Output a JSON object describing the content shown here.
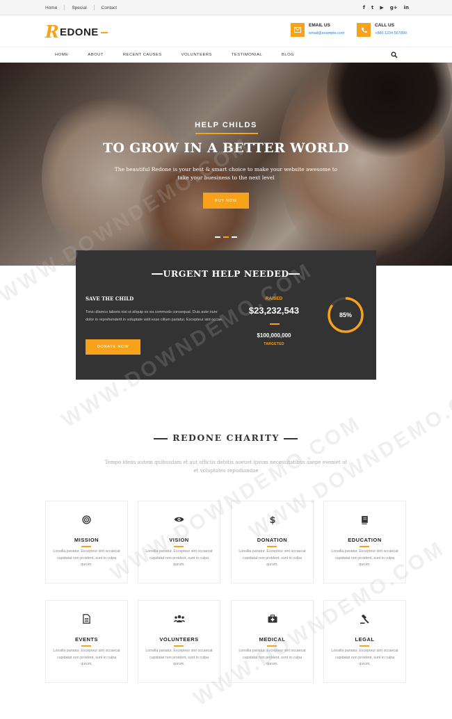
{
  "topbar": {
    "links": [
      "Home",
      "Special",
      "Contact"
    ],
    "social_icons": [
      "facebook-icon",
      "twitter-icon",
      "youtube-icon",
      "google-plus-icon",
      "linkedin-icon"
    ],
    "social_glyphs": [
      "f",
      "t",
      "▶",
      "g+",
      "in"
    ]
  },
  "header": {
    "logo_r": "R",
    "logo_text": "EDONE",
    "email_title": "EMAIL US",
    "email_value": "email@example.com",
    "call_title": "CALL US",
    "call_value": "+880 1234 567890"
  },
  "nav": {
    "items": [
      "HOME",
      "ABOUT",
      "RECENT CAUSES",
      "VOLUNTEERS",
      "TESTIMONIAL",
      "BLOG"
    ]
  },
  "hero": {
    "kicker": "HELP CHILDS",
    "headline": "TO GROW IN A BETTER WORLD",
    "subtitle": "The beautiful Redone is your best & smart choice to make your website awesome to take your buesiness to the next level",
    "button": "BUY NOW",
    "slides": 3,
    "active_slide": 2
  },
  "urgent": {
    "heading": "URGENT HELP NEEDED",
    "cause_title": "SAVE THE CHILD",
    "cause_text": "Tons ullamco laboris nisi ut aliquip ex ea commodo consequat. Duis aute irure dolor in reprehenderit in voluptate velit esse cillum pariatur. Excepteur sint occae.",
    "donate_button": "DONATE NOW",
    "raised_label": "RAISED",
    "raised_value": "$23,232,543",
    "target_value": "$100,000,000",
    "target_label": "TARGETED",
    "percent_label": "85%",
    "percent": 85
  },
  "charity": {
    "title": "REDONE CHARITY",
    "subtitle": "Tempo ideus autem quibusdam et aut officiis debitis aoeuet ipsum necessitatibus saepe eveniet ut et voluptates repudiandae",
    "cards": [
      {
        "title": "MISSION",
        "icon": "target-icon",
        "text": "Lonsilla pariatur. Excepteur sint occaecat cupidatat non proident, sunt in culpa qurum."
      },
      {
        "title": "VISION",
        "icon": "eye-icon",
        "text": "Lonsilla pariatur. Excepteur sint occaecat cupidatat non proident, sunt in culpa qurum."
      },
      {
        "title": "DONATION",
        "icon": "dollar-icon",
        "text": "Lonsilla pariatur. Excepteur sint occaecat cupidatat non proident, sunt in culpa qurum."
      },
      {
        "title": "EDUCATION",
        "icon": "book-icon",
        "text": "Lonsilla pariatur. Excepteur sint occaecat cupidatat non proident, sunt in culpa qurum."
      },
      {
        "title": "EVENTS",
        "icon": "document-icon",
        "text": "Lonsilla pariatur. Excepteur sint occaecat cupidatat non proident, sunt in culpa qurum."
      },
      {
        "title": "VOLUNTEERS",
        "icon": "users-icon",
        "text": "Lonsilla pariatur. Excepteur sint occaecat cupidatat non proident, sunt in culpa qurum."
      },
      {
        "title": "MEDICAL",
        "icon": "medkit-icon",
        "text": "Lonsilla pariatur. Excepteur sint occaecat cupidatat non proident, sunt in culpa qurum."
      },
      {
        "title": "LEGAL",
        "icon": "gavel-icon",
        "text": "Lonsilla pariatur. Excepteur sint occaecat cupidatat non proident, sunt in culpa qurum."
      }
    ]
  },
  "watermark": "WWW.DOWNDEMO.COM",
  "colors": {
    "accent": "#f7a21b",
    "dark_panel": "#333333",
    "link": "#2b7fd8"
  }
}
